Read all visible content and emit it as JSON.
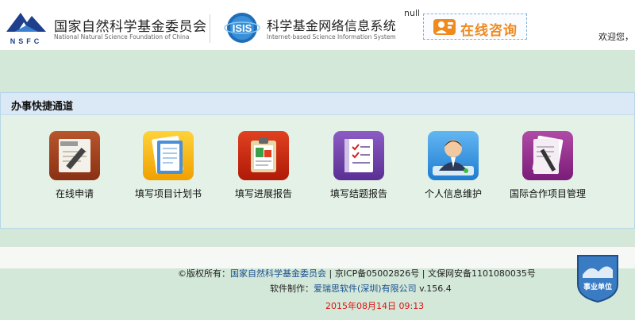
{
  "header": {
    "nsfc_name_cn": "国家自然科学基金委员会",
    "nsfc_name_en": "National Natural Science Foundation of China",
    "nsfc_logo_text": "NSFC",
    "isis_logo_text": "ISIS",
    "isis_name_cn": "科学基金网络信息系统",
    "isis_name_en": "Internet-based Science Information System",
    "null_text": "null",
    "consult_label": "在线咨询",
    "welcome_text": "欢迎您，"
  },
  "quick_panel": {
    "title": "办事快捷通道",
    "items": [
      {
        "label": "在线申请",
        "icon": "pen-paper-icon",
        "color": "#a3421f"
      },
      {
        "label": "填写项目计划书",
        "icon": "notebook-icon",
        "color": "#f5b800"
      },
      {
        "label": "填写进展报告",
        "icon": "clipboard-icon",
        "color": "#c42a10"
      },
      {
        "label": "填写结题报告",
        "icon": "checklist-icon",
        "color": "#6b3aa8"
      },
      {
        "label": "个人信息维护",
        "icon": "user-avatar-icon",
        "color": "#2a8ee0"
      },
      {
        "label": "国际合作项目管理",
        "icon": "document-pen-icon",
        "color": "#91308e"
      }
    ]
  },
  "footer": {
    "copyright_prefix": "©版权所有：",
    "copyright_owner": "国家自然科学基金委员会",
    "icp": " | 京ICP备05002826号 | 文保网安备1101080035号",
    "software_prefix": "软件制作：",
    "software_company": "爱瑞思软件(深圳)有限公司",
    "version": " v.156.4",
    "datetime": "2015年08月14日 09:13",
    "badge_text": "事业单位"
  }
}
